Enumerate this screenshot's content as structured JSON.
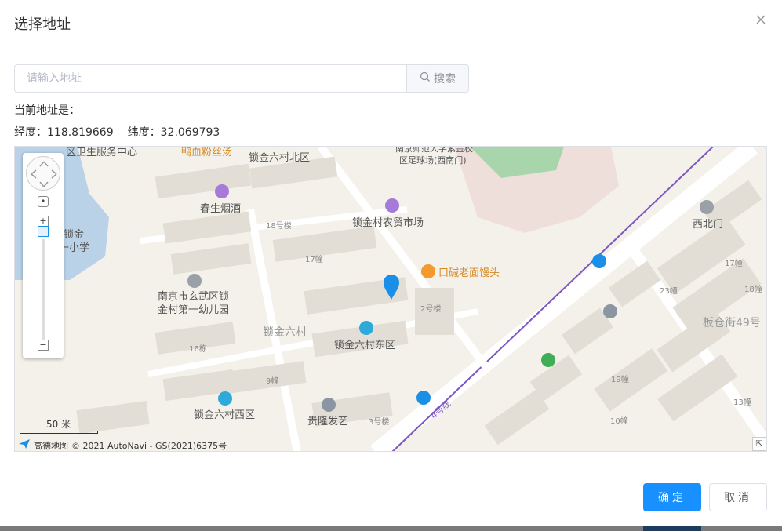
{
  "dialog": {
    "title": "选择地址",
    "close_icon": "close-icon"
  },
  "search": {
    "placeholder": "请输入地址",
    "value": "",
    "button_label": "搜索",
    "button_icon": "search-icon"
  },
  "current_address": {
    "label": "当前地址是："
  },
  "coordinates": {
    "lng_label": "经度：118.819669",
    "lat_label": "纬度：32.069793"
  },
  "map": {
    "labels": {
      "l1": "区卫生服务中心",
      "l2": "鸭血粉丝汤",
      "l3": "锁金六村北区",
      "l4": "南京师范大学紫金校",
      "l5": "区足球场(西南门)",
      "l6": "春生烟酒",
      "l7": "18号楼",
      "l8": "锁金村农贸市场",
      "l9": "锁金",
      "l10": "一小学",
      "l11": "17幢",
      "l12": "口碱老面馒头",
      "l13": "南京市玄武区锁",
      "l14": "金村第一幼儿园",
      "l15": "2号楼",
      "l16": "锁金六村",
      "l17": "锁金六村东区",
      "l18": "16栋",
      "l19": "9幢",
      "l20": "锁金六村西区",
      "l21": "贵隆发艺",
      "l22": "3号楼",
      "l23": "4号线",
      "l24": "西北门",
      "l25": "17幢",
      "l26": "23幢",
      "l27": "18幢",
      "l28": "板仓街49号",
      "l29": "19幢",
      "l30": "13幢",
      "l31": "10幢"
    },
    "scale_label": "50 米",
    "logo_text": "高德地图",
    "attribution": "© 2021 AutoNavi - GS(2021)6375号",
    "zoom_in": "+",
    "zoom_out": "−",
    "corner_icon": "⇱"
  },
  "footer": {
    "confirm_label": "确定",
    "cancel_label": "取消"
  },
  "colors": {
    "primary": "#1890ff",
    "marker": "#1a8fe8",
    "metro_line": "#7e57c2"
  }
}
